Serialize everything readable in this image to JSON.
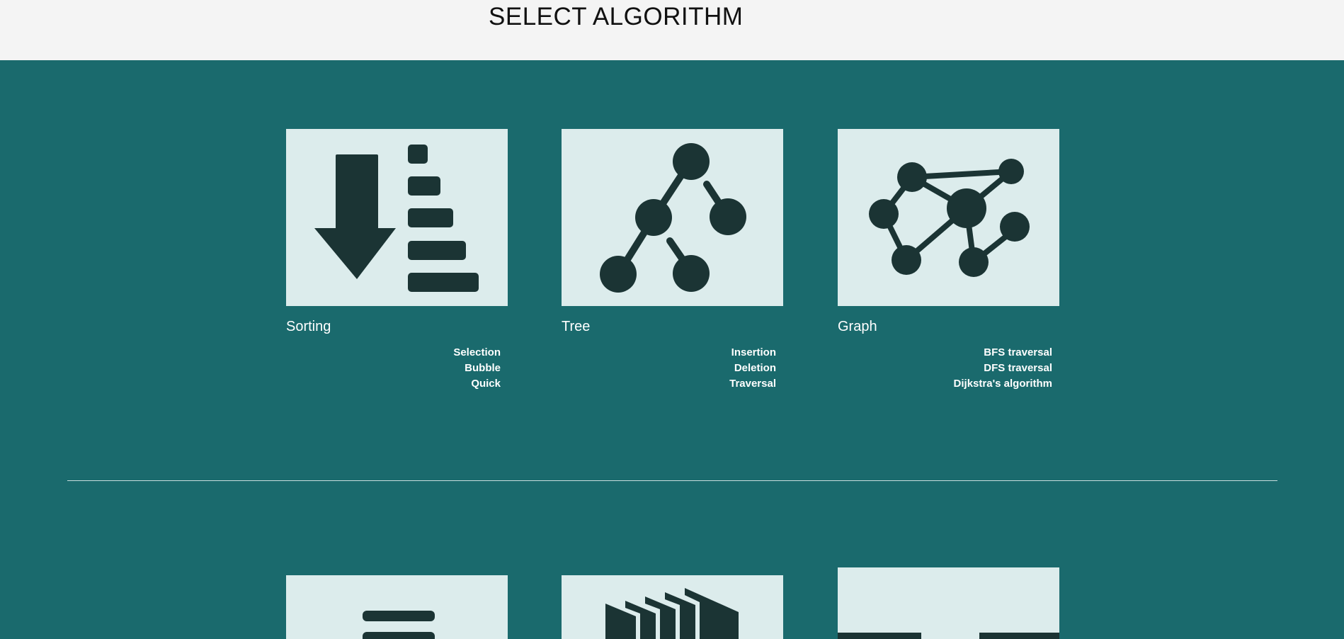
{
  "header": {
    "title": "SELECT ALGORITHM"
  },
  "cards": [
    {
      "label": "Sorting",
      "icon": "sorting-icon",
      "links": [
        "Selection",
        "Bubble",
        "Quick"
      ]
    },
    {
      "label": "Tree",
      "icon": "tree-icon",
      "links": [
        "Insertion",
        "Deletion",
        "Traversal"
      ]
    },
    {
      "label": "Graph",
      "icon": "graph-icon",
      "links": [
        "BFS traversal",
        "DFS traversal",
        "Dijkstra's algorithm"
      ]
    }
  ],
  "next_row": [
    {
      "icon": "list-icon"
    },
    {
      "icon": "stacked-pages-icon"
    },
    {
      "icon": "blocks-icon"
    }
  ],
  "colors": {
    "header_bg": "#f4f4f4",
    "main_bg": "#1a6a6d",
    "card_bg": "#dcecec",
    "icon_fill": "#1b3434",
    "text": "#ffffff"
  }
}
